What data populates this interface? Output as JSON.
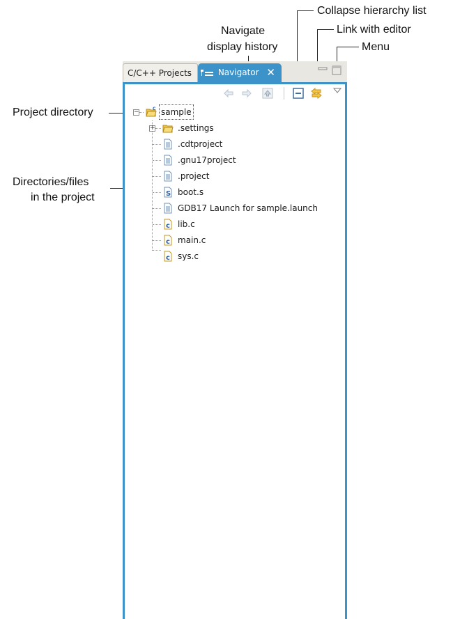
{
  "callouts": {
    "collapse": "Collapse hierarchy list",
    "link": "Link with editor",
    "menu": "Menu",
    "navigate_line1": "Navigate",
    "navigate_line2": "display history",
    "project_dir": "Project directory",
    "dirs_line1": "Directories/files",
    "dirs_line2": "in the project"
  },
  "tabs": {
    "inactive": "C/C++ Projects",
    "active": "Navigator"
  },
  "tree": {
    "root": "sample",
    "items": [
      {
        "label": ".settings",
        "icon": "folder-icon"
      },
      {
        "label": ".cdtproject",
        "icon": "file-icon"
      },
      {
        "label": ".gnu17project",
        "icon": "file-icon"
      },
      {
        "label": ".project",
        "icon": "file-icon"
      },
      {
        "label": "boot.s",
        "icon": "asm-file-icon"
      },
      {
        "label": "GDB17 Launch for sample.launch",
        "icon": "file-icon"
      },
      {
        "label": "lib.c",
        "icon": "c-file-icon"
      },
      {
        "label": "main.c",
        "icon": "c-file-icon"
      },
      {
        "label": "sys.c",
        "icon": "c-file-icon"
      }
    ]
  },
  "colors": {
    "accent": "#3b93c9",
    "folder": "#f2c94c"
  }
}
